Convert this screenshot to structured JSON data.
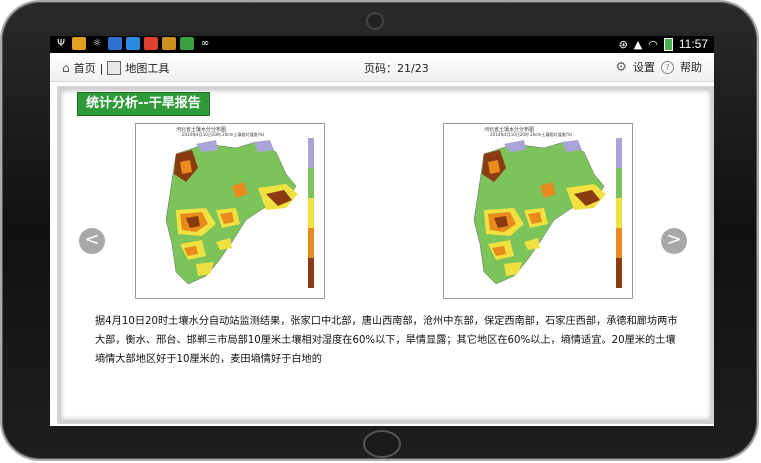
{
  "statusbar": {
    "time": "11:57",
    "icons": [
      "usb-icon",
      "brightness-icon",
      "app-icon",
      "browser-icon",
      "map-app-icon",
      "chrome-icon",
      "app-green-icon",
      "wechat-icon"
    ]
  },
  "toolbar": {
    "home_label": "首页",
    "separator": "|",
    "map_tools_label": "地图工具",
    "page_label": "页码：21/23",
    "settings_label": "设置",
    "help_label": "帮助"
  },
  "section": {
    "title": "统计分析--干旱报告"
  },
  "maps": [
    {
      "title": "河北省土壤水分分布图",
      "subtitle": "2014年4月10日20时 20cm土壤相对湿度(%)"
    },
    {
      "title": "河北省土壤水分分布图",
      "subtitle": "2014年4月10日20时 20cm土壤相对湿度(%)"
    }
  ],
  "nav": {
    "prev": "<",
    "next": ">"
  },
  "report": {
    "text": "据4月10日20时土壤水分自动站监测结果，张家口中北部，唐山西南部，沧州中东部，保定西南部，石家庄西部，承德和廊坊两市大部，衡水、邢台、邯郸三市局部10厘米土壤相对湿度在60%以下，旱情显露；其它地区在60%以上，墒情适宜。20厘米的土壤墒情大部地区好于10厘米的，麦田墒情好于白地的"
  },
  "colors": {
    "title_bg": "#2f9a3a",
    "map_green": "#7cc35a",
    "map_yellow": "#f0e040",
    "map_orange": "#e88a1c",
    "map_brown": "#8a3b12",
    "map_purple": "#a9a4d8"
  }
}
